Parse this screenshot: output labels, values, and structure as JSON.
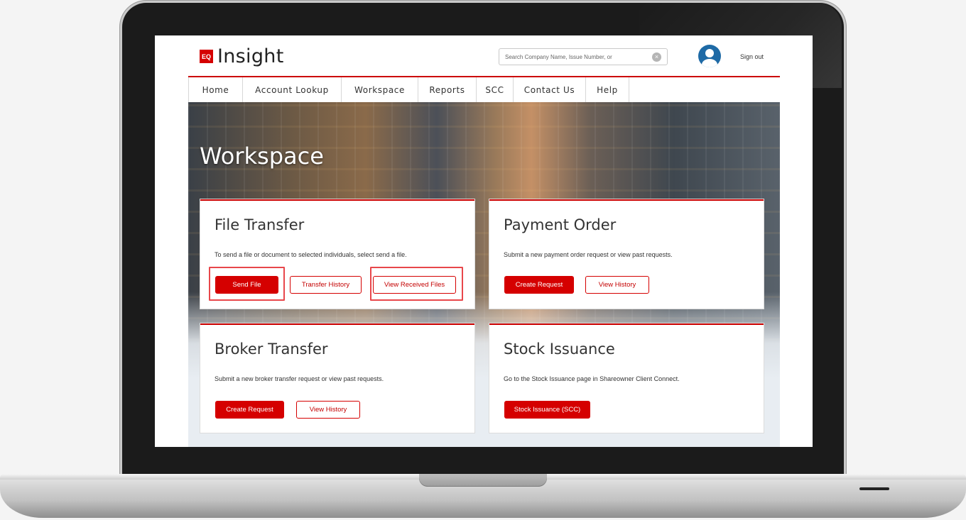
{
  "brand": {
    "badge": "EQ",
    "name": "Insight"
  },
  "search": {
    "placeholder": "Search Company Name, Issue Number, or",
    "clear_icon": "clear-circle-icon"
  },
  "header": {
    "avatar_icon": "user-avatar-icon",
    "signout_label": "Sign out"
  },
  "nav": {
    "items": [
      {
        "label": "Home"
      },
      {
        "label": "Account Lookup"
      },
      {
        "label": "Workspace"
      },
      {
        "label": "Reports"
      },
      {
        "label": "SCC"
      },
      {
        "label": "Contact Us"
      },
      {
        "label": "Help"
      }
    ]
  },
  "hero": {
    "title": "Workspace"
  },
  "cards": {
    "file_transfer": {
      "title": "File Transfer",
      "desc": "To send a file or document to selected individuals, select send a file.",
      "buttons": [
        "Send File",
        "Transfer History",
        "View Received Files"
      ]
    },
    "payment_order": {
      "title": "Payment Order",
      "desc": "Submit a new payment order request or view past requests.",
      "buttons": [
        "Create Request",
        "View History"
      ]
    },
    "broker_transfer": {
      "title": "Broker Transfer",
      "desc": "Submit a new broker transfer request or view past requests.",
      "buttons": [
        "Create Request",
        "View History"
      ]
    },
    "stock_issuance": {
      "title": "Stock Issuance",
      "desc": "Go to the Stock Issuance page in Shareowner Client Connect.",
      "buttons": [
        "Stock Issuance (SCC)"
      ]
    }
  },
  "colors": {
    "accent": "#d50000",
    "highlight": "#e8474b"
  }
}
